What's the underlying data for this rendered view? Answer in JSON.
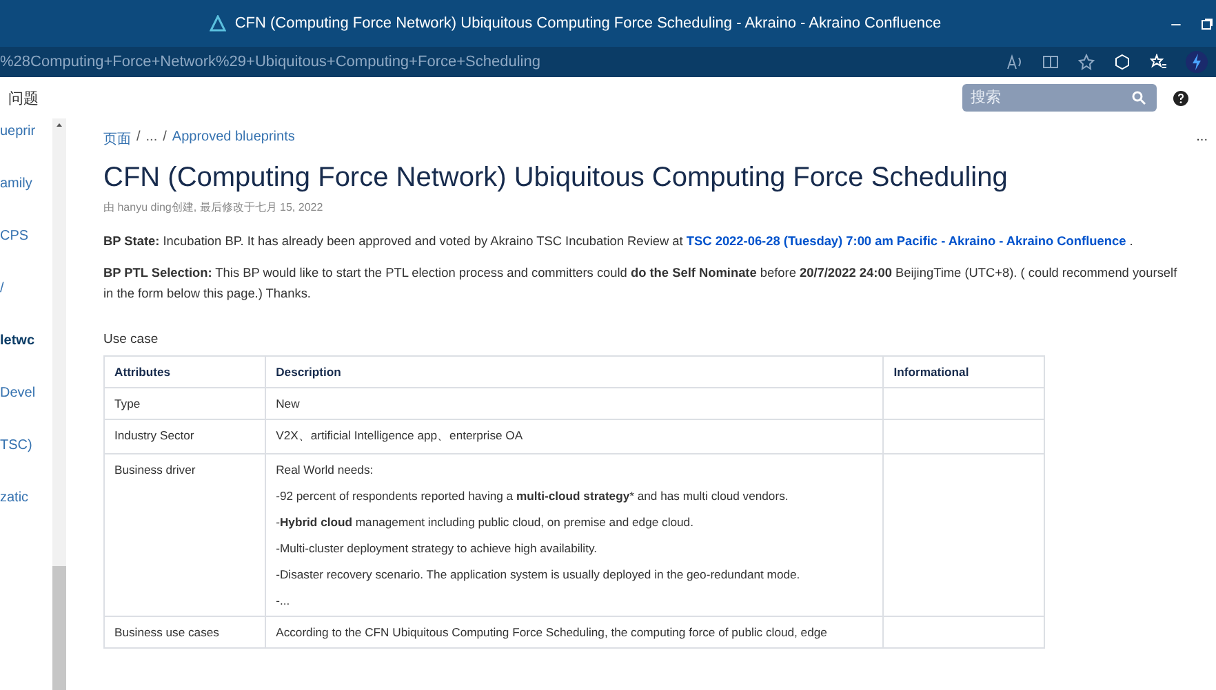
{
  "window": {
    "title": "CFN (Computing Force Network) Ubiquitous Computing Force Scheduling - Akraino - Akraino Confluence",
    "minimize": "–"
  },
  "address_bar": {
    "url": "%28Computing+Force+Network%29+Ubiquitous+Computing+Force+Scheduling"
  },
  "header": {
    "menu_item": "问题",
    "search": {
      "placeholder": "搜索"
    }
  },
  "sidebar": {
    "items": [
      {
        "label": "ueprir",
        "selected": false
      },
      {
        "label": "amily",
        "selected": false
      },
      {
        "label": "CPS",
        "selected": false
      },
      {
        "label": "/",
        "selected": false
      },
      {
        "label": "letwc",
        "selected": true
      },
      {
        "label": "Devel",
        "selected": false
      },
      {
        "label": "TSC)",
        "selected": false
      },
      {
        "label": "zatic",
        "selected": false
      }
    ]
  },
  "breadcrumb": {
    "root": "页面",
    "separator_1": "/",
    "ellipsis": "...",
    "separator_2": "/",
    "current": "Approved blueprints"
  },
  "more": "...",
  "page": {
    "title": "CFN (Computing Force Network) Ubiquitous Computing Force Scheduling",
    "byline": "由 hanyu ding创建, 最后修改于七月 15, 2022",
    "paragraphs": [
      [
        {
          "kind": "bold",
          "text": "BP State:"
        },
        {
          "kind": "plain",
          "text": " Incubation BP. It has already been approved and voted by Akraino TSC Incubation Review at "
        },
        {
          "kind": "link",
          "text": "TSC 2022-06-28 (Tuesday) 7:00 am Pacific - Akraino - Akraino Confluence"
        },
        {
          "kind": "plain",
          "text": " ."
        }
      ],
      [
        {
          "kind": "bold",
          "text": "BP PTL Selection:"
        },
        {
          "kind": "plain",
          "text": " This BP would like to start the PTL election process and committers could "
        },
        {
          "kind": "bold",
          "text": "do the Self Nominate"
        },
        {
          "kind": "plain",
          "text": " before "
        },
        {
          "kind": "bold",
          "text": "20/7/2022 24:00"
        },
        {
          "kind": "plain",
          "text": " BeijingTime (UTC+8). ( could recommend yourself in the form below this page.) Thanks."
        }
      ]
    ],
    "table_caption": "Use case",
    "table": {
      "columns": [
        "Attributes",
        "Description",
        "Informational"
      ],
      "rows": [
        {
          "cells": [
            "Type",
            [
              "New"
            ],
            ""
          ]
        },
        {
          "cells": [
            "Industry Sector",
            [
              "V2X、artificial Intelligence app、enterprise OA"
            ],
            ""
          ]
        },
        {
          "cells": [
            "Business driver",
            [
              "Real World needs:",
              "-92 percent of respondents reported having a **multi-cloud strategy*** and has multi cloud vendors.",
              "-**Hybrid cloud** management including public cloud, on premise and edge cloud.",
              "-Multi-cluster deployment strategy to achieve high availability.",
              "-Disaster recovery scenario. The application system is usually deployed in the geo-redundant mode.",
              "-..."
            ],
            ""
          ]
        },
        {
          "cells": [
            "Business use cases",
            [
              "According to the CFN  Ubiquitous Computing Force Scheduling, the computing force of public cloud, edge"
            ],
            ""
          ]
        }
      ]
    }
  }
}
